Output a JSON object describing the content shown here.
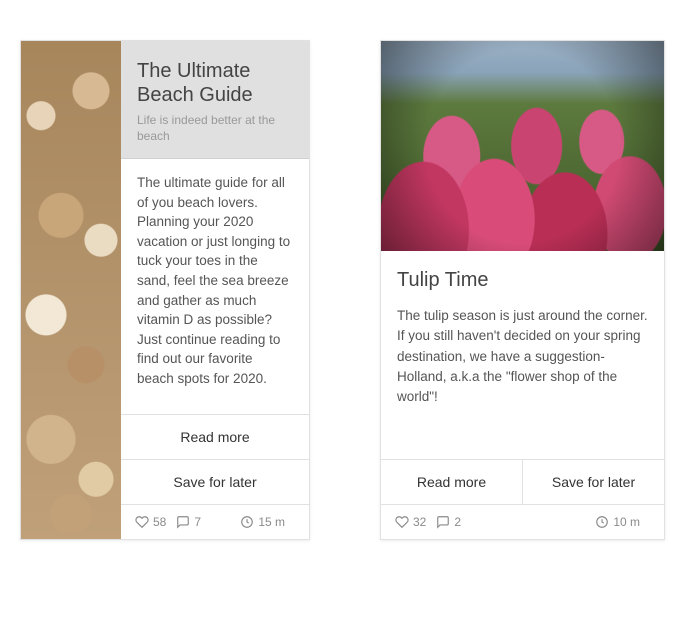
{
  "cards": [
    {
      "title": "The Ultimate Beach Guide",
      "subtitle": "Life is indeed better at the beach",
      "body": "The ultimate guide for all of you beach lovers. Planning your 2020 vacation or just longing to tuck your toes in the sand, feel the sea breeze and gather as much vitamin D as possible? Just continue reading to find out our favorite beach spots for 2020.",
      "actions": {
        "read_more": "Read more",
        "save_later": "Save for later"
      },
      "stats": {
        "likes": "58",
        "comments": "7",
        "time": "15 m"
      },
      "image": "shells"
    },
    {
      "title": "Tulip Time",
      "body": "The tulip season is just around the corner. If you still haven't decided on your spring destination, we have a suggestion- Holland, a.k.a the \"flower shop of the world\"!",
      "actions": {
        "read_more": "Read more",
        "save_later": "Save for later"
      },
      "stats": {
        "likes": "32",
        "comments": "2",
        "time": "10 m"
      },
      "image": "tulips"
    }
  ]
}
